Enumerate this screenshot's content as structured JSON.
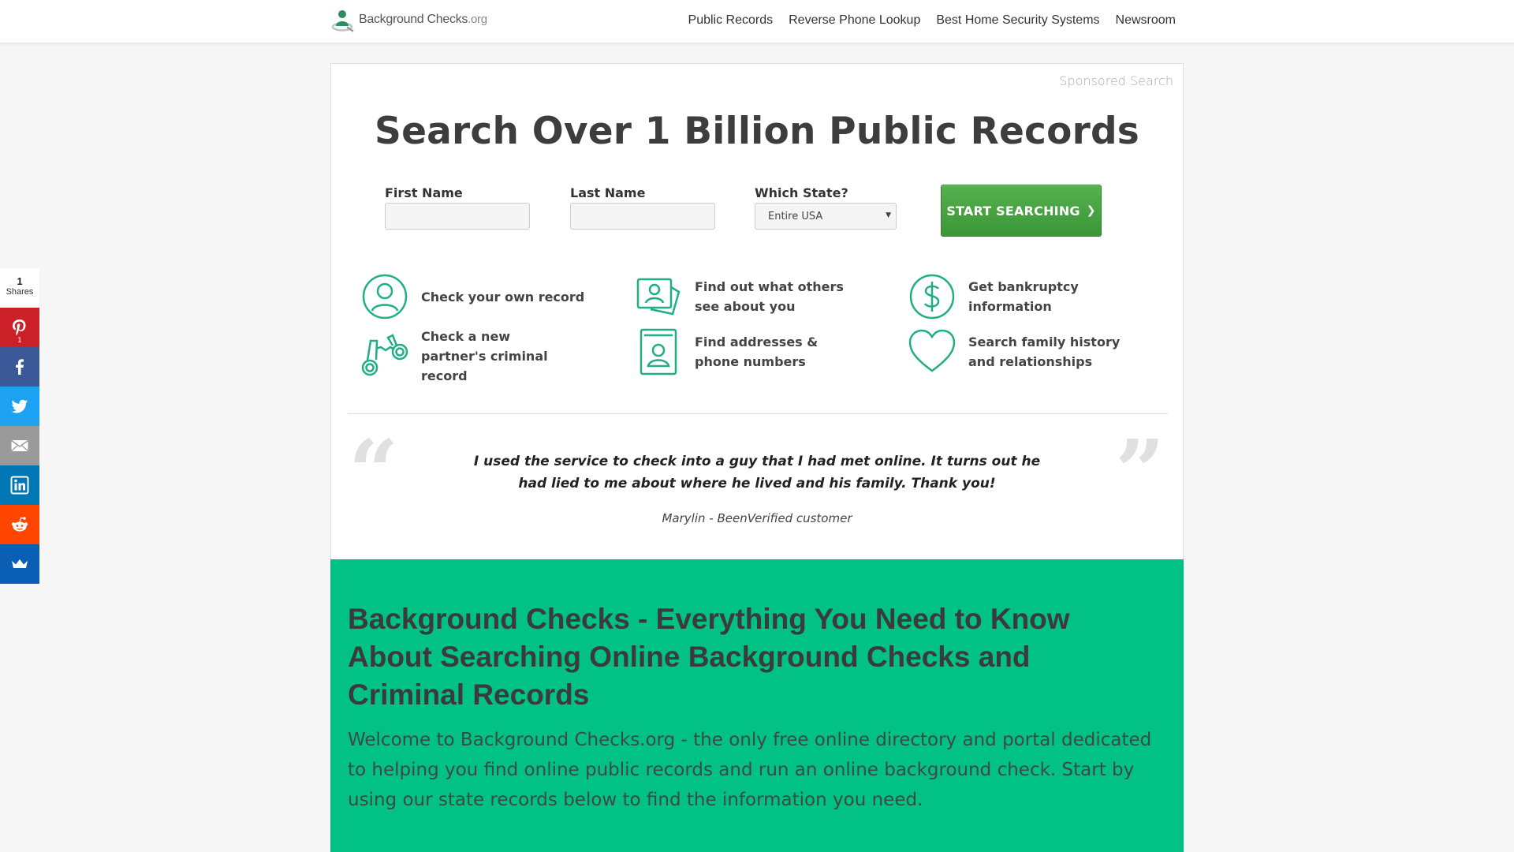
{
  "header": {
    "logo_text": "Background Checks",
    "logo_suffix": ".org",
    "nav": [
      "Public Records",
      "Reverse Phone Lookup",
      "Best Home Security Systems",
      "Newsroom"
    ]
  },
  "sharebar": {
    "count": "1",
    "count_label": "Shares",
    "pinterest_count": "1",
    "buttons": [
      {
        "name": "pinterest",
        "color": "#cb2027"
      },
      {
        "name": "facebook",
        "color": "#3b5998"
      },
      {
        "name": "twitter",
        "color": "#1da1f2"
      },
      {
        "name": "email",
        "color": "#9a9a9a"
      },
      {
        "name": "linkedin",
        "color": "#0077b5"
      },
      {
        "name": "reddit",
        "color": "#ff4500"
      },
      {
        "name": "sumome",
        "color": "#0a5fb4"
      }
    ]
  },
  "search": {
    "sponsored": "Sponsored Search",
    "headline": "Search Over 1 Billion Public Records",
    "first_name_label": "First Name",
    "first_name_value": "",
    "last_name_label": "Last Name",
    "last_name_value": "",
    "state_label": "Which State?",
    "state_value": "Entire USA",
    "button_label": "START SEARCHING",
    "accent_color": "#1fae86"
  },
  "features": [
    {
      "icon": "user-circle-icon",
      "label": "Check your own record"
    },
    {
      "icon": "id-card-icon",
      "label": "Find out what others see about you"
    },
    {
      "icon": "dollar-circle-icon",
      "label": "Get bankruptcy information"
    },
    {
      "icon": "handcuffs-icon",
      "label": "Check a new partner's criminal record"
    },
    {
      "icon": "address-book-icon",
      "label": "Find addresses & phone numbers"
    },
    {
      "icon": "heart-icon",
      "label": "Search family history and relationships"
    }
  ],
  "testimonial": {
    "open_quote": "“",
    "close_quote": "”",
    "text": "I used the service to check into a guy that I had met online. It turns out he had lied to me about where he lived and his family. Thank you!",
    "author": "Marylin - BeenVerified customer"
  },
  "intro": {
    "title": "Background Checks - Everything You Need to Know About Searching Online Background Checks and Criminal Records",
    "body": "Welcome to Background Checks.org - the only free online directory and portal dedicated to helping you find online public records and run an online background check. Start by using our state records below to find the information you need.",
    "bg_color": "#02c185"
  }
}
